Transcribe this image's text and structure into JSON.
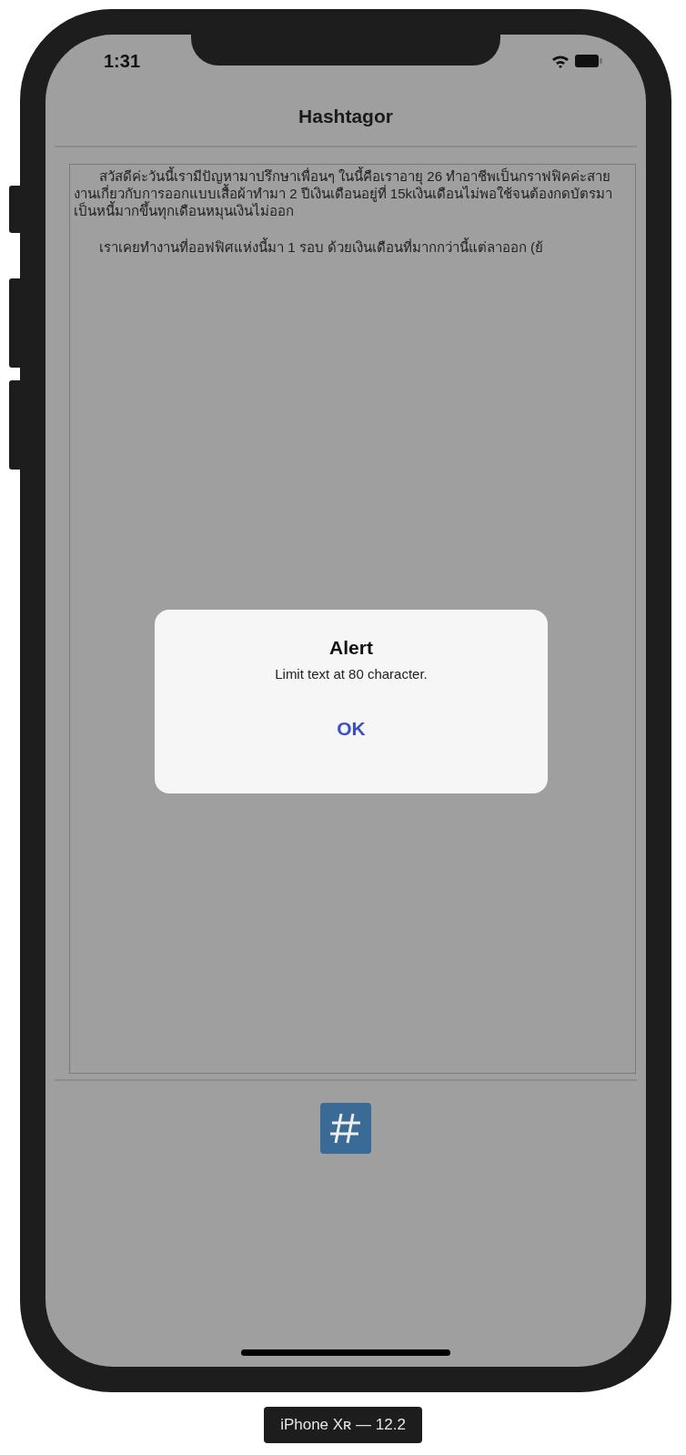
{
  "status_bar": {
    "time": "1:31"
  },
  "nav_bar": {
    "title": "Hashtagor"
  },
  "text_view": {
    "paragraphs": [
      "สวัสดีค่ะวันนี้เรามีปัญหามาปรึกษาเพื่อนๆ ในนี้คือเราอายุ 26 ทำอาชีพเป็นกราฟฟิคค่ะสายงานเกี่ยวกับการออกแบบเสื้อผ้าทำมา 2 ปีเงินเดือนอยู่ที่ 15kเงินเดือนไม่พอใช้จนต้องกดบัตรมาเป็นหนี้มากขึ้นทุกเดือนหมุนเงินไม่ออก",
      "เราเคยทำงานที่ออฟฟิศแห่งนี้มา 1 รอบ ด้วยเงินเดือนที่มากกว่านี้แต่ลาออก (ย้"
    ]
  },
  "alert": {
    "title": "Alert",
    "message": "Limit text at 80 character.",
    "buttons": [
      "OK"
    ]
  },
  "device_label": "iPhone Xʀ — 12.2"
}
